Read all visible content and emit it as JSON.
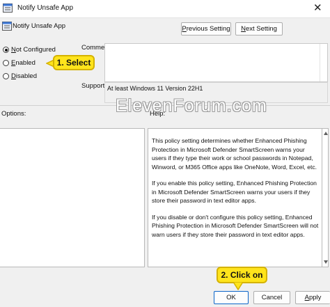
{
  "window": {
    "title": "Notify Unsafe App",
    "close_glyph": "✕"
  },
  "header": {
    "policy_name": "Notify Unsafe App"
  },
  "nav": {
    "previous_label_pre": "",
    "previous_accel": "P",
    "previous_label_post": "revious Setting",
    "next_label_pre": "",
    "next_accel": "N",
    "next_label_post": "ext Setting"
  },
  "state_options": [
    {
      "pre": "",
      "accel": "N",
      "post": "ot Configured",
      "checked": true
    },
    {
      "pre": "",
      "accel": "E",
      "post": "nabled",
      "checked": false
    },
    {
      "pre": "",
      "accel": "D",
      "post": "isabled",
      "checked": false
    }
  ],
  "comment": {
    "label": "Comment:",
    "value": ""
  },
  "supported": {
    "label": "Supported on:",
    "value": "At least Windows 11 Version 22H1"
  },
  "options": {
    "label": "Options:"
  },
  "help": {
    "label": "Help:",
    "paragraphs": [
      "This policy setting determines whether Enhanced Phishing Protection in Microsoft Defender SmartScreen warns your users if they type their work or school passwords in Notepad, Winword, or M365 Office apps like OneNote, Word, Excel, etc.",
      "If you enable this policy setting, Enhanced Phishing Protection in Microsoft Defender SmartScreen warns your users if they store their password in text editor apps.",
      "If you disable or don't configure this policy setting, Enhanced Phishing Protection in Microsoft Defender SmartScreen will not warn users if they store their password in text editor apps."
    ]
  },
  "footer": {
    "ok_label": "OK",
    "cancel_label": "Cancel",
    "apply_label_pre": "",
    "apply_accel": "A",
    "apply_label_post": "pply"
  },
  "annotations": {
    "select": "1. Select",
    "click_on": "2. Click on"
  },
  "watermark": "ElevenForum.com",
  "colors": {
    "callout_fill": "#ffe41c",
    "callout_border": "#d4b200",
    "primary_button_border": "#0a64c8",
    "icon_blue": "#3c78d8"
  },
  "icons": {
    "window_icon": "policy-settings-icon",
    "scroll_up": "triangle-up",
    "scroll_down": "triangle-down"
  }
}
